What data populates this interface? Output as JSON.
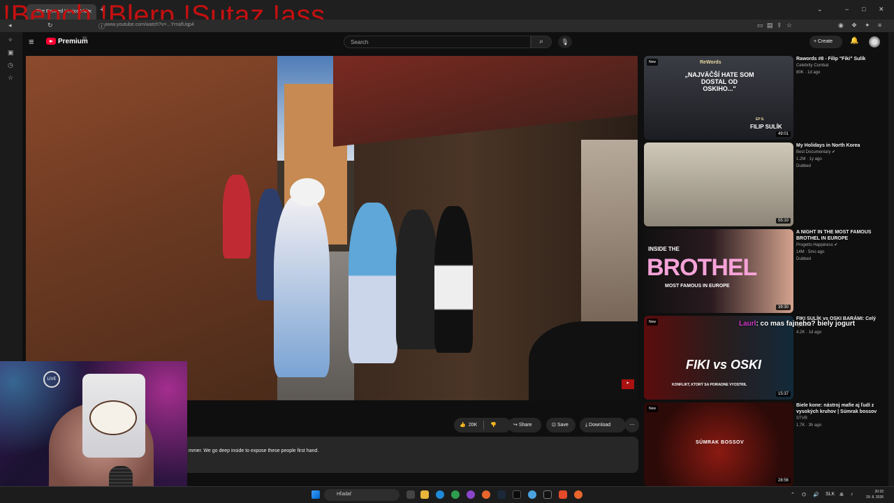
{
  "browser": {
    "tab_title": "The Banned Venice Vide",
    "url": "www.youtube.com/watch?v=...YrnafUqp4",
    "overlay_text": "!Bench !Blerp !Sutaz !ass"
  },
  "youtube": {
    "brand": "Premium",
    "region": "SK",
    "search_placeholder": "Search",
    "create_label": "Create"
  },
  "video": {
    "like_count": "20K",
    "share_label": "Share",
    "save_label": "Save",
    "download_label": "Download",
    "description": "mmer. We go deep inside to expose these people first hand."
  },
  "recommendations": [
    {
      "title": "Rawords #8 - Filip \"Fiki\" Sulík",
      "channel": "Celebrity Combat",
      "stats": "80K · 1d ago",
      "extra": "",
      "duration": "49:01",
      "badge": "New",
      "thumb_caption": "„NAJVÄČŠÍ HATE SOM DOSTAL OD OSKIHO...\"",
      "thumb_sub": "FILIP SULÍK",
      "thumb_logo": "ReWords",
      "thumb_ep": "EP 8."
    },
    {
      "title": "My Holidays in North Korea",
      "channel": "Best Documentary",
      "stats": "1.2M · 1y ago",
      "extra": "Dubbed",
      "duration": "55:10",
      "badge": "",
      "thumb_caption": "",
      "thumb_sub": ""
    },
    {
      "title": "A NIGHT IN THE MOST FAMOUS BROTHEL IN EUROPE",
      "channel": "Progetto Happiness",
      "stats": "14M · 5mo ago",
      "extra": "Dubbed",
      "duration": "39:30",
      "badge": "",
      "thumb_caption": "BROTHEL",
      "thumb_top": "INSIDE THE",
      "thumb_sub": "MOST FAMOUS IN EUROPE"
    },
    {
      "title": "FIKI SULÍK vs OSKI BARÁMI: Celý",
      "channel": "ojousTV",
      "stats": "4.2K · 1d ago",
      "extra": "",
      "duration": "15:37",
      "badge": "New",
      "thumb_caption": "FIKI vs OSKI",
      "thumb_sub": "KONFLIKT, KTORÝ SA PORIADNE VYOSTRIL"
    },
    {
      "title": "Biele kone: nástroj mafie aj ľudí z vysokých kruhov | Súmrak bossov",
      "channel": "STVR",
      "stats": "1.7K · 3h ago",
      "extra": "",
      "duration": "28:56",
      "badge": "New",
      "thumb_caption": "SÚMRAK BOSSOV",
      "thumb_sub": ""
    }
  ],
  "chat_overlay": {
    "name": "Laurl",
    "message": ": co mas fajneho? biely jogurt"
  },
  "webcam": {
    "live_label": "LIVE",
    "jar_label": "KRODONANT"
  },
  "taskbar": {
    "search_placeholder": "Hľadať",
    "language": "SLK",
    "time": "20:33",
    "date": "29. 8. 2026"
  },
  "colors": {
    "yt_red": "#ff0033",
    "overlay_red": "#c41010",
    "chat_name": "#d23ac9"
  }
}
